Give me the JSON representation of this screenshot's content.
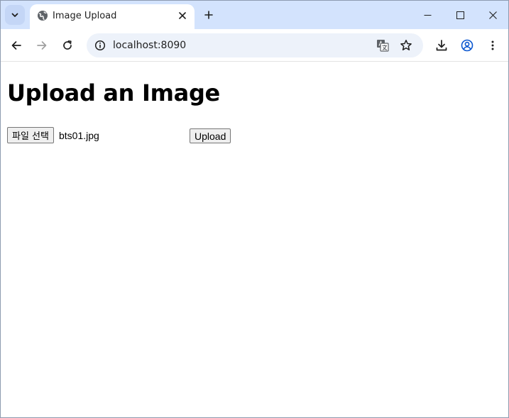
{
  "browser": {
    "tab": {
      "title": "Image Upload",
      "favicon": "globe-icon"
    },
    "address_bar": {
      "url": "localhost:8090"
    },
    "icons": {
      "tab_search": "chevron-down-icon",
      "close_tab": "close-icon",
      "new_tab": "plus-icon",
      "minimize": "minimize-icon",
      "maximize": "maximize-icon",
      "close_window": "close-icon",
      "back": "arrow-left-icon",
      "forward": "arrow-right-icon",
      "reload": "reload-icon",
      "site_info": "info-icon",
      "translate": "translate-icon",
      "bookmark": "star-icon",
      "downloads": "download-icon",
      "profile": "profile-icon",
      "menu": "kebab-menu-icon"
    },
    "colors": {
      "tabstrip": "#d3e3fd",
      "omnibox": "#edf2fa"
    }
  },
  "page": {
    "title": "Upload an Image",
    "form": {
      "file_button_label": "파일 선택",
      "selected_file": "bts01.jpg",
      "upload_label": "Upload"
    }
  }
}
